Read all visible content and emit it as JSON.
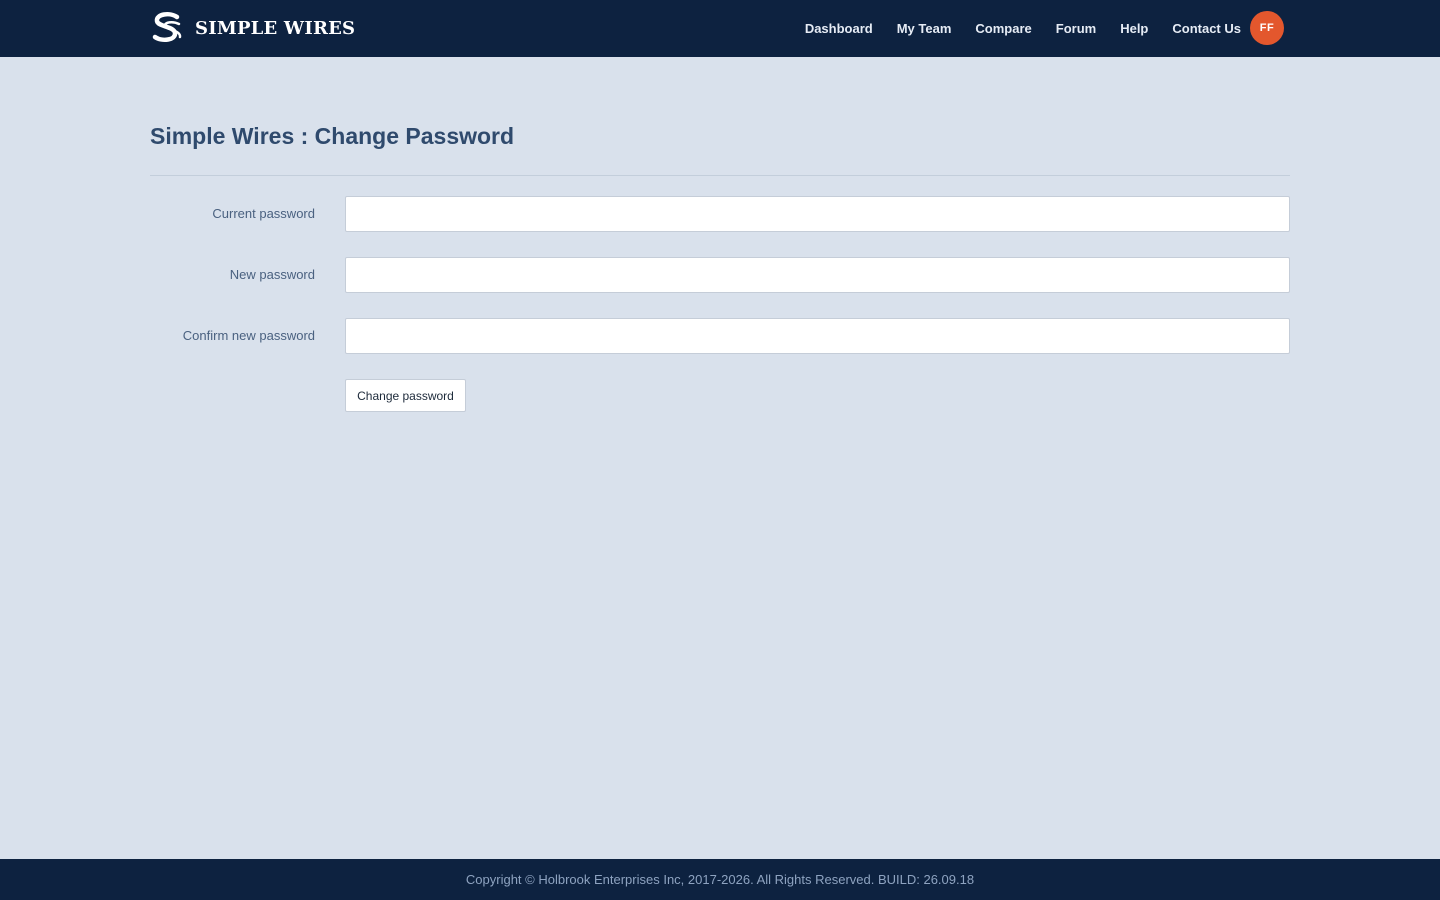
{
  "brand": {
    "name": "SIMPLE WIRES",
    "logo_icon": "simple-wires-logo-icon"
  },
  "nav": {
    "items": [
      {
        "label": "Dashboard"
      },
      {
        "label": "My Team"
      },
      {
        "label": "Compare"
      },
      {
        "label": "Forum"
      },
      {
        "label": "Help"
      },
      {
        "label": "Contact Us"
      }
    ],
    "avatar_initials": "FF"
  },
  "page": {
    "title": "Simple Wires : Change Password"
  },
  "form": {
    "fields": [
      {
        "label": "Current password",
        "value": ""
      },
      {
        "label": "New password",
        "value": ""
      },
      {
        "label": "Confirm new password",
        "value": ""
      }
    ],
    "submit_label": "Change password"
  },
  "footer": {
    "text": "Copyright © Holbrook Enterprises Inc, 2017-2026. All Rights Reserved. BUILD: 26.09.18"
  },
  "colors": {
    "navbar": "#0d2240",
    "background": "#d9e1ec",
    "avatar": "#e3572d",
    "title": "#2f4a6d"
  }
}
